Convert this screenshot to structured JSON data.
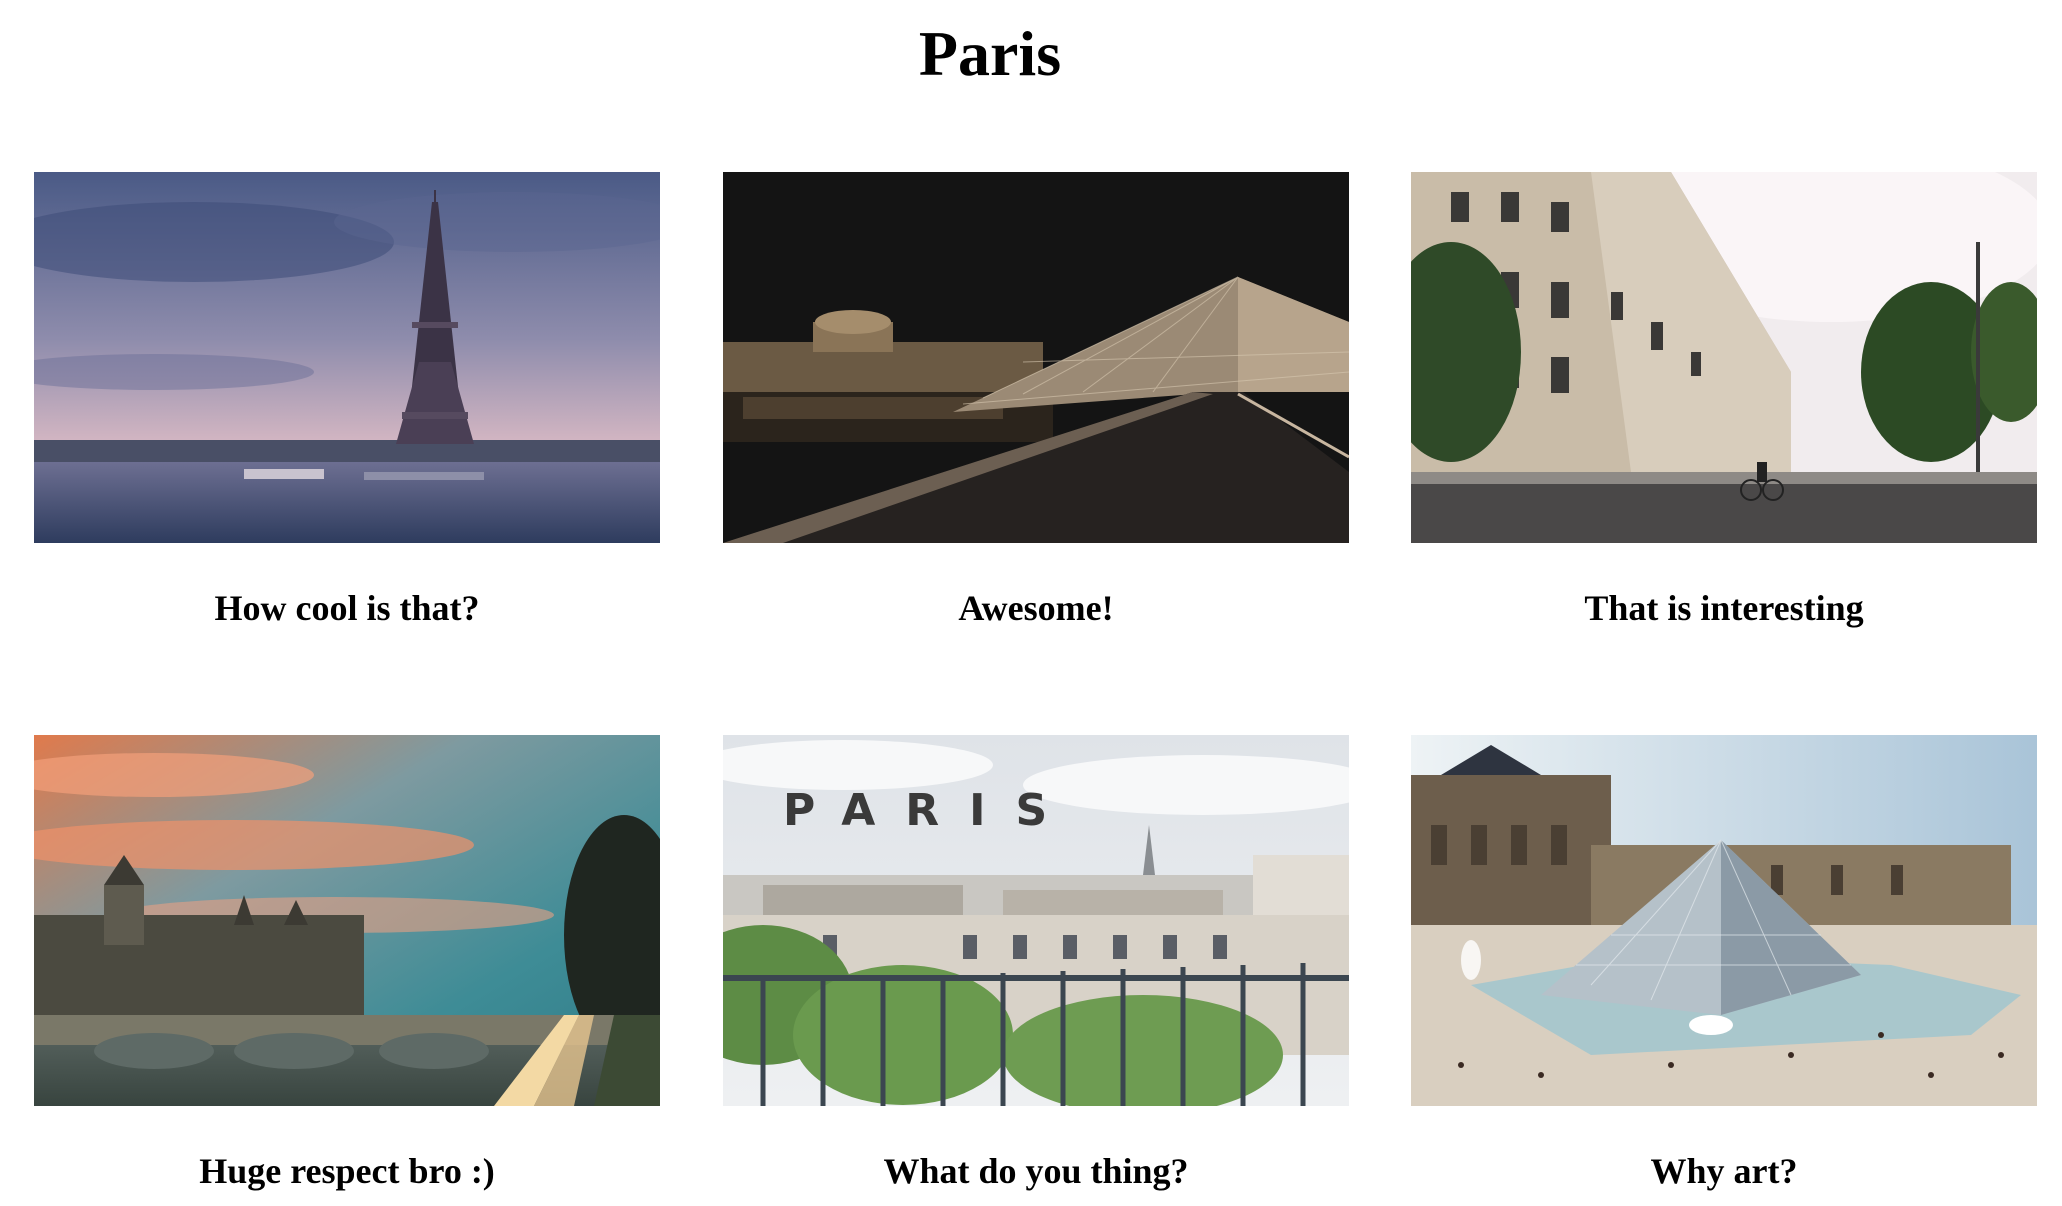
{
  "page": {
    "title": "Paris"
  },
  "gallery": {
    "items": [
      {
        "caption": "How cool is that?",
        "image": "eiffel-tower-seine-dusk-photo"
      },
      {
        "caption": "Awesome!",
        "image": "louvre-pyramid-night-photo"
      },
      {
        "caption": "That is interesting",
        "image": "paris-street-building-photo"
      },
      {
        "caption": "Huge respect bro :)",
        "image": "conciergerie-bridge-sunset-photo"
      },
      {
        "caption": "What do you thing?",
        "image": "paris-rooftops-balcony-photo",
        "sign_text": "PARIS"
      },
      {
        "caption": "Why art?",
        "image": "louvre-pyramid-day-photo"
      }
    ]
  }
}
